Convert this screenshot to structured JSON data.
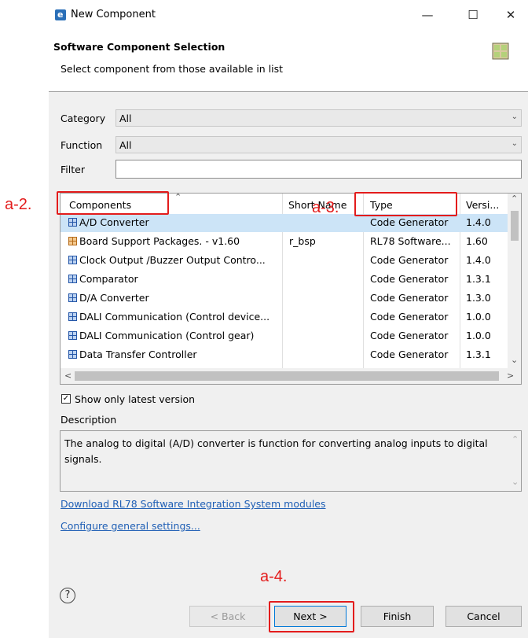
{
  "window": {
    "title": "New Component",
    "minimize": "—",
    "maximize": "☐",
    "close": "✕"
  },
  "header": {
    "title": "Software Component Selection",
    "subtitle": "Select component from those available in list"
  },
  "filters": {
    "category_label": "Category",
    "category_value": "All",
    "function_label": "Function",
    "function_value": "All",
    "filter_label": "Filter",
    "filter_value": ""
  },
  "table": {
    "columns": [
      "Components",
      "Short Name",
      "Type",
      "Versi..."
    ],
    "rows": [
      {
        "name": "A/D Converter",
        "short": "",
        "type": "Code Generator",
        "version": "1.4.0",
        "icon": "component-icon"
      },
      {
        "name": "Board Support Packages. - v1.60",
        "short": "r_bsp",
        "type": "RL78 Software...",
        "version": "1.60",
        "icon": "package-icon"
      },
      {
        "name": "Clock Output /Buzzer Output Contro...",
        "short": "",
        "type": "Code Generator",
        "version": "1.4.0",
        "icon": "component-icon"
      },
      {
        "name": "Comparator",
        "short": "",
        "type": "Code Generator",
        "version": "1.3.1",
        "icon": "component-icon"
      },
      {
        "name": "D/A Converter",
        "short": "",
        "type": "Code Generator",
        "version": "1.3.0",
        "icon": "component-icon"
      },
      {
        "name": "DALI Communication (Control device...",
        "short": "",
        "type": "Code Generator",
        "version": "1.0.0",
        "icon": "component-icon"
      },
      {
        "name": "DALI Communication (Control gear)",
        "short": "",
        "type": "Code Generator",
        "version": "1.0.0",
        "icon": "component-icon"
      },
      {
        "name": "Data Transfer Controller",
        "short": "",
        "type": "Code Generator",
        "version": "1.3.1",
        "icon": "component-icon"
      }
    ],
    "selected_index": 0
  },
  "options": {
    "show_latest_label": "Show only latest version",
    "show_latest_checked": true
  },
  "description": {
    "label": "Description",
    "text": "The analog to digital (A/D) converter is function for converting analog inputs to digital signals."
  },
  "links": {
    "download": "Download RL78 Software Integration System modules",
    "configure": "Configure general settings..."
  },
  "buttons": {
    "help": "?",
    "back": "< Back",
    "next": "Next >",
    "finish": "Finish",
    "cancel": "Cancel"
  },
  "annotations": {
    "a2": "a-2.",
    "a3": "a-3.",
    "a4": "a-4."
  },
  "colors": {
    "highlight": "#e31c1c",
    "selection": "#cce4f7",
    "link": "#1f5fb5"
  }
}
